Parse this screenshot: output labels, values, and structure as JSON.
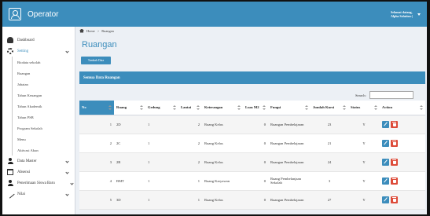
{
  "app": {
    "title": "Operator"
  },
  "user": {
    "line1": "Selamat datang,",
    "line2": "Alpha Solution ("
  },
  "sidebar": {
    "dashboard": "Dashboard",
    "setting": "Setting",
    "sub_items": [
      "Biodata sekolah",
      "Ruangan",
      "Jabatan",
      "Tahun Keuangan",
      "Tahun Akademik",
      "Tahun PSB",
      "Program Sekolah",
      "Menu",
      "Aktivasi Akun"
    ],
    "data_master": "Data Master",
    "absensi": "Absensi",
    "penerimaan": "Penerimaan Siswa Baru",
    "nilai": "Nilai"
  },
  "breadcrumb": {
    "home": "Home",
    "sep": ">",
    "current": "Ruangan"
  },
  "page": {
    "title": "Ruangan",
    "add_button": "Tambah Data",
    "box_title": "Semua Data Ruangan",
    "search_label": "Search:",
    "search_value": ""
  },
  "table": {
    "headers": [
      "No",
      "Ruang",
      "Gedung",
      "Lantai",
      "Keterangan",
      "Luas M2",
      "Fungsi",
      "Jumlah Kursi",
      "Status",
      "Action"
    ],
    "rows": [
      [
        "1",
        "2D",
        "1",
        "2",
        "Ruang Kelas",
        "0",
        "Ruangan Pembelajaran",
        "23",
        "Y"
      ],
      [
        "2",
        "2C",
        "1",
        "2",
        "Ruang Kelas",
        "0",
        "Ruangan Pembelajaran",
        "21",
        "Y"
      ],
      [
        "3",
        "2B",
        "1",
        "2",
        "Ruang Kelas",
        "0",
        "Ruangan Pembelajaran",
        "24",
        "Y"
      ],
      [
        "4",
        "BMT",
        "1",
        "1",
        "Ruang Karyawan",
        "0",
        "Ruang Pembelanjaan Sekolah",
        "3",
        "Y"
      ],
      [
        "5",
        "3D",
        "1",
        "1",
        "Ruang Kelas",
        "0",
        "Ruangan Pembelajaran",
        "27",
        "Y"
      ]
    ]
  }
}
